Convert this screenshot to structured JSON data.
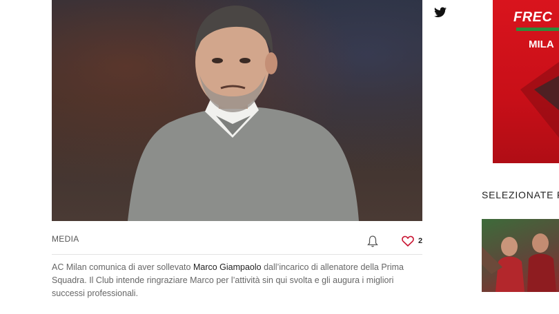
{
  "article": {
    "category": "MEDIA",
    "likes": "2",
    "text_before": "AC Milan comunica di aver sollevato ",
    "text_name": "Marco Giampaolo",
    "text_after": " dall’incarico di allenatore della Prima Squadra. Il Club intende ringraziare Marco per l’attività sin qui svolta e gli augura i migliori successi professionali."
  },
  "sidebar": {
    "ad_brand": "FREC",
    "ad_city": "MILA",
    "section_title": "SELEZIONATE PE"
  },
  "icons": {
    "share": "twitter-icon",
    "notify": "bell-icon",
    "like": "heart-icon"
  },
  "colors": {
    "accent": "#c8102e",
    "ad_red": "#d9141d",
    "ad_green": "#2e8b3a"
  }
}
